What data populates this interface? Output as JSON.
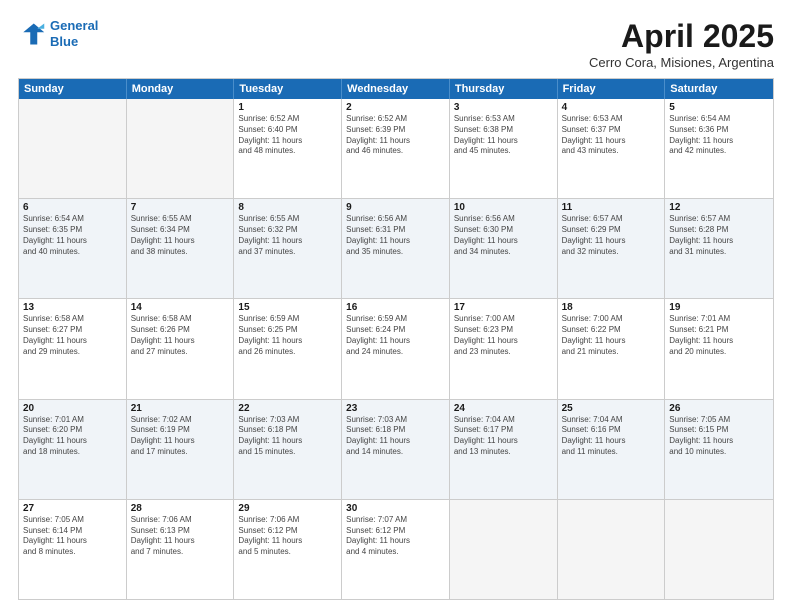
{
  "logo": {
    "line1": "General",
    "line2": "Blue"
  },
  "title": "April 2025",
  "subtitle": "Cerro Cora, Misiones, Argentina",
  "headers": [
    "Sunday",
    "Monday",
    "Tuesday",
    "Wednesday",
    "Thursday",
    "Friday",
    "Saturday"
  ],
  "rows": [
    [
      {
        "day": "",
        "info": ""
      },
      {
        "day": "",
        "info": ""
      },
      {
        "day": "1",
        "info": "Sunrise: 6:52 AM\nSunset: 6:40 PM\nDaylight: 11 hours\nand 48 minutes."
      },
      {
        "day": "2",
        "info": "Sunrise: 6:52 AM\nSunset: 6:39 PM\nDaylight: 11 hours\nand 46 minutes."
      },
      {
        "day": "3",
        "info": "Sunrise: 6:53 AM\nSunset: 6:38 PM\nDaylight: 11 hours\nand 45 minutes."
      },
      {
        "day": "4",
        "info": "Sunrise: 6:53 AM\nSunset: 6:37 PM\nDaylight: 11 hours\nand 43 minutes."
      },
      {
        "day": "5",
        "info": "Sunrise: 6:54 AM\nSunset: 6:36 PM\nDaylight: 11 hours\nand 42 minutes."
      }
    ],
    [
      {
        "day": "6",
        "info": "Sunrise: 6:54 AM\nSunset: 6:35 PM\nDaylight: 11 hours\nand 40 minutes."
      },
      {
        "day": "7",
        "info": "Sunrise: 6:55 AM\nSunset: 6:34 PM\nDaylight: 11 hours\nand 38 minutes."
      },
      {
        "day": "8",
        "info": "Sunrise: 6:55 AM\nSunset: 6:32 PM\nDaylight: 11 hours\nand 37 minutes."
      },
      {
        "day": "9",
        "info": "Sunrise: 6:56 AM\nSunset: 6:31 PM\nDaylight: 11 hours\nand 35 minutes."
      },
      {
        "day": "10",
        "info": "Sunrise: 6:56 AM\nSunset: 6:30 PM\nDaylight: 11 hours\nand 34 minutes."
      },
      {
        "day": "11",
        "info": "Sunrise: 6:57 AM\nSunset: 6:29 PM\nDaylight: 11 hours\nand 32 minutes."
      },
      {
        "day": "12",
        "info": "Sunrise: 6:57 AM\nSunset: 6:28 PM\nDaylight: 11 hours\nand 31 minutes."
      }
    ],
    [
      {
        "day": "13",
        "info": "Sunrise: 6:58 AM\nSunset: 6:27 PM\nDaylight: 11 hours\nand 29 minutes."
      },
      {
        "day": "14",
        "info": "Sunrise: 6:58 AM\nSunset: 6:26 PM\nDaylight: 11 hours\nand 27 minutes."
      },
      {
        "day": "15",
        "info": "Sunrise: 6:59 AM\nSunset: 6:25 PM\nDaylight: 11 hours\nand 26 minutes."
      },
      {
        "day": "16",
        "info": "Sunrise: 6:59 AM\nSunset: 6:24 PM\nDaylight: 11 hours\nand 24 minutes."
      },
      {
        "day": "17",
        "info": "Sunrise: 7:00 AM\nSunset: 6:23 PM\nDaylight: 11 hours\nand 23 minutes."
      },
      {
        "day": "18",
        "info": "Sunrise: 7:00 AM\nSunset: 6:22 PM\nDaylight: 11 hours\nand 21 minutes."
      },
      {
        "day": "19",
        "info": "Sunrise: 7:01 AM\nSunset: 6:21 PM\nDaylight: 11 hours\nand 20 minutes."
      }
    ],
    [
      {
        "day": "20",
        "info": "Sunrise: 7:01 AM\nSunset: 6:20 PM\nDaylight: 11 hours\nand 18 minutes."
      },
      {
        "day": "21",
        "info": "Sunrise: 7:02 AM\nSunset: 6:19 PM\nDaylight: 11 hours\nand 17 minutes."
      },
      {
        "day": "22",
        "info": "Sunrise: 7:03 AM\nSunset: 6:18 PM\nDaylight: 11 hours\nand 15 minutes."
      },
      {
        "day": "23",
        "info": "Sunrise: 7:03 AM\nSunset: 6:18 PM\nDaylight: 11 hours\nand 14 minutes."
      },
      {
        "day": "24",
        "info": "Sunrise: 7:04 AM\nSunset: 6:17 PM\nDaylight: 11 hours\nand 13 minutes."
      },
      {
        "day": "25",
        "info": "Sunrise: 7:04 AM\nSunset: 6:16 PM\nDaylight: 11 hours\nand 11 minutes."
      },
      {
        "day": "26",
        "info": "Sunrise: 7:05 AM\nSunset: 6:15 PM\nDaylight: 11 hours\nand 10 minutes."
      }
    ],
    [
      {
        "day": "27",
        "info": "Sunrise: 7:05 AM\nSunset: 6:14 PM\nDaylight: 11 hours\nand 8 minutes."
      },
      {
        "day": "28",
        "info": "Sunrise: 7:06 AM\nSunset: 6:13 PM\nDaylight: 11 hours\nand 7 minutes."
      },
      {
        "day": "29",
        "info": "Sunrise: 7:06 AM\nSunset: 6:12 PM\nDaylight: 11 hours\nand 5 minutes."
      },
      {
        "day": "30",
        "info": "Sunrise: 7:07 AM\nSunset: 6:12 PM\nDaylight: 11 hours\nand 4 minutes."
      },
      {
        "day": "",
        "info": ""
      },
      {
        "day": "",
        "info": ""
      },
      {
        "day": "",
        "info": ""
      }
    ]
  ]
}
